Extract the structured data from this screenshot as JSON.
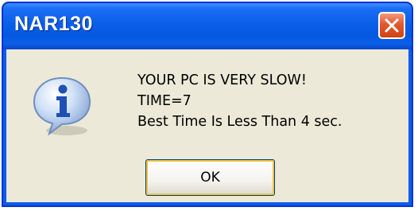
{
  "window": {
    "title": "NAR130"
  },
  "dialog": {
    "icon": "information-icon",
    "lines": [
      "YOUR PC IS VERY SLOW!",
      "TIME=7",
      "Best Time Is Less Than 4 sec."
    ]
  },
  "buttons": {
    "ok_label": "OK"
  },
  "colors": {
    "titlebar": "#0a5fe8",
    "close_button": "#e2582f",
    "client_background": "#ece9d8"
  }
}
